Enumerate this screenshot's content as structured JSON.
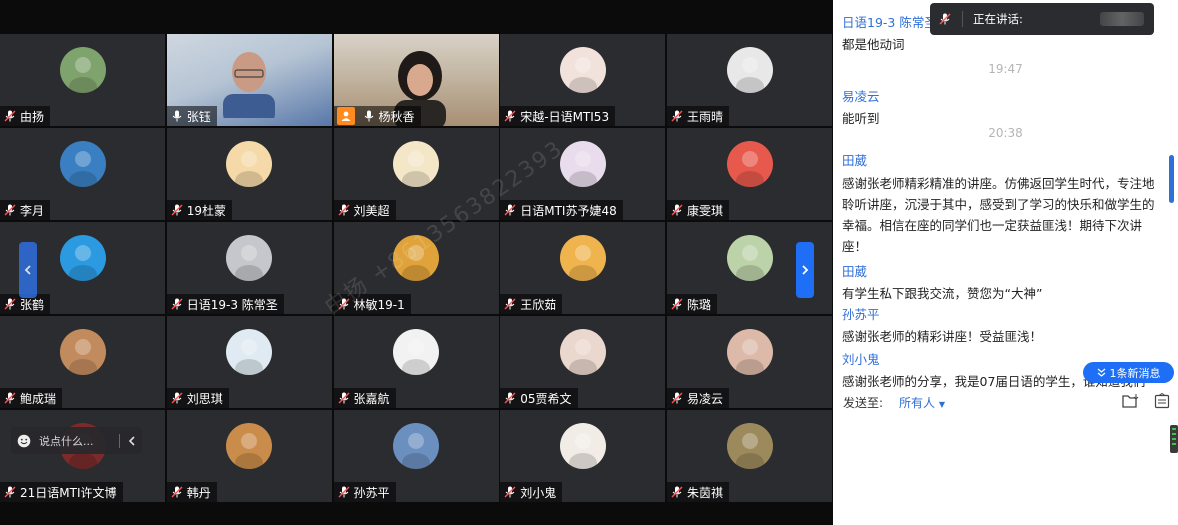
{
  "grid": {
    "tiles": [
      {
        "name": "由扬",
        "avatar": "#7fa36c"
      },
      {
        "name": "张钰",
        "avatar": "video"
      },
      {
        "name": "杨秋香",
        "avatar": "video"
      },
      {
        "name": "宋越-日语MTI53",
        "avatar": "#f2e2dc"
      },
      {
        "name": "王雨晴",
        "avatar": "#e8e8e8"
      },
      {
        "name": "李月",
        "avatar": "#3a7fc2"
      },
      {
        "name": "19杜蒙",
        "avatar": "#f5d9a8"
      },
      {
        "name": "刘美超",
        "avatar": "#f4e7c8"
      },
      {
        "name": "日语MTI苏予婕48",
        "avatar": "#e9dcec"
      },
      {
        "name": "康雯琪",
        "avatar": "#e7594c"
      },
      {
        "name": "张鹤",
        "avatar": "#2b9ae0"
      },
      {
        "name": "日语19-3 陈常圣",
        "avatar": "#c5c7cc"
      },
      {
        "name": "林敏19-1",
        "avatar": "#e0a23a"
      },
      {
        "name": "王欣茹",
        "avatar": "#f0b44e"
      },
      {
        "name": "陈璐",
        "avatar": "#bcd2a8"
      },
      {
        "name": "鲍成瑞",
        "avatar": "#c28b5e"
      },
      {
        "name": "刘思琪",
        "avatar": "#dfeaf3"
      },
      {
        "name": "张嘉航",
        "avatar": "#f2f2f2"
      },
      {
        "name": "05贾希文",
        "avatar": "#ead7ce"
      },
      {
        "name": "易凌云",
        "avatar": "#dcb9a8"
      },
      {
        "name": "21日语MTI许文博",
        "avatar": "#7a2b2b"
      },
      {
        "name": "韩丹",
        "avatar": "#c98c4b"
      },
      {
        "name": "孙苏平",
        "avatar": "#6b8fbf"
      },
      {
        "name": "刘小鬼",
        "avatar": "#f1ece6"
      },
      {
        "name": "朱茵祺",
        "avatar": "#9c8a5c"
      }
    ],
    "watermark": "由扬 +8613563822393"
  },
  "chat_input": {
    "placeholder": "说点什么..."
  },
  "speaking": {
    "label": "正在讲话:"
  },
  "chat": {
    "messages": [
      {
        "sender": "日语19-3 陈常圣",
        "text": "都是他动词"
      },
      {
        "time": "19:47"
      },
      {
        "sender": "易凌云",
        "text": "能听到"
      },
      {
        "time": "20:38"
      },
      {
        "sender": "田葳",
        "text": "感谢张老师精彩精准的讲座。仿佛返回学生时代，专注地聆听讲座，沉浸于其中，感受到了学习的快乐和做学生的幸福。相信在座的同学们也一定获益匪浅！期待下次讲座！"
      },
      {
        "sender": "田葳",
        "text": "有学生私下跟我交流，赞您为“大神”"
      },
      {
        "sender": "孙苏平",
        "text": "感谢张老师的精彩讲座！受益匪浅！"
      },
      {
        "sender": "刘小鬼",
        "text": "感谢张老师的分享，我是07届日语的学生，谁知道我们"
      }
    ],
    "new_msg_label": "1条新消息",
    "send_to_label": "发送至:",
    "send_to_target": "所有人"
  },
  "colors": {
    "accent": "#1e6ff5",
    "sender": "#2f6fd8",
    "tile": "#2b2c2f"
  }
}
